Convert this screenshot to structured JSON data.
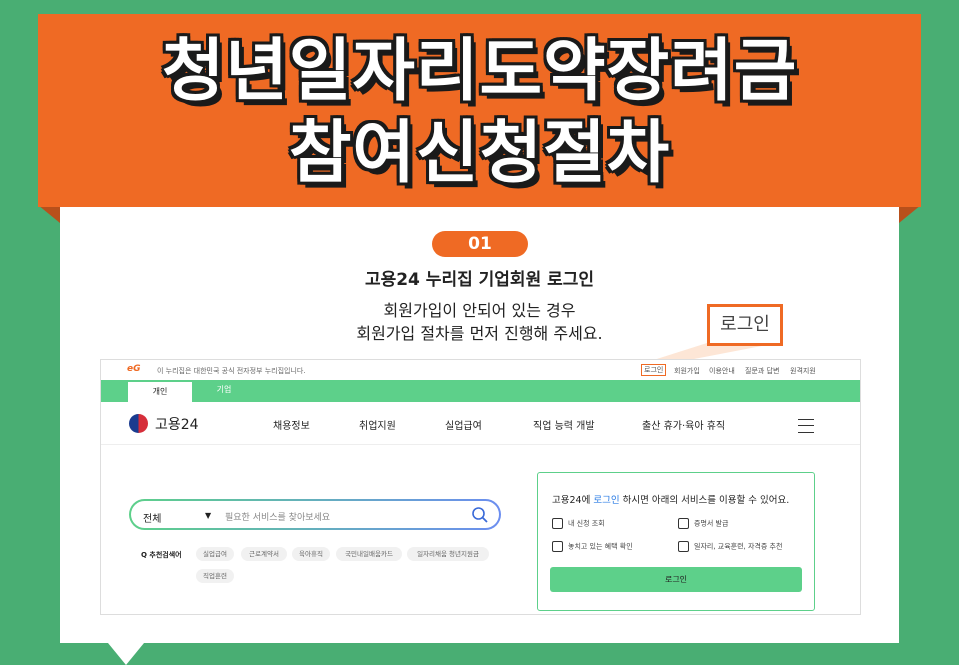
{
  "banner": {
    "line1": "청년일자리도약장려금",
    "line2": "참여신청절차"
  },
  "step": {
    "number": "01",
    "heading": "고용24 누리집 기업회원 로그인",
    "desc_line1": "회원가입이 안되어 있는 경우",
    "desc_line2": "회원가입 절차를 먼저 진행해 주세요.",
    "zoom_label": "로그인"
  },
  "site": {
    "top_notice": "이 누리집은 대한민국 공식 전자정부 누리집입니다.",
    "eg_mark": "eG",
    "util_links": [
      "로그인",
      "회원가입",
      "이용안내",
      "질문과 답변",
      "원격지원"
    ],
    "tabs": [
      "개인",
      "기업"
    ],
    "logo_text": "고용24",
    "nav": [
      "채용정보",
      "취업지원",
      "실업급여",
      "직업 능력 개발",
      "출산 휴가·육아 휴직"
    ],
    "search": {
      "category": "전체",
      "arrow": "▼",
      "placeholder": "필요한 서비스를 찾아보세요"
    },
    "recommended_label": "Q 추천검색어",
    "chips": [
      "실업급여",
      "근로계약서",
      "육아휴직",
      "국민내일배움카드",
      "일자리채움 청년지원금",
      "직업훈련"
    ],
    "panel": {
      "title_pre": "고용24에 ",
      "title_link": "로그인",
      "title_post": " 하시면 아래의 서비스를 이용할 수 있어요.",
      "services": [
        "내 신청 조회",
        "증명서 발급",
        "놓치고 있는 혜택 확인",
        "일자리, 교육훈련, 자격증 추천"
      ],
      "button": "로그인"
    }
  },
  "colors": {
    "background": "#49ae73",
    "accent": "#ef6a24",
    "site_green": "#5dd08a"
  }
}
